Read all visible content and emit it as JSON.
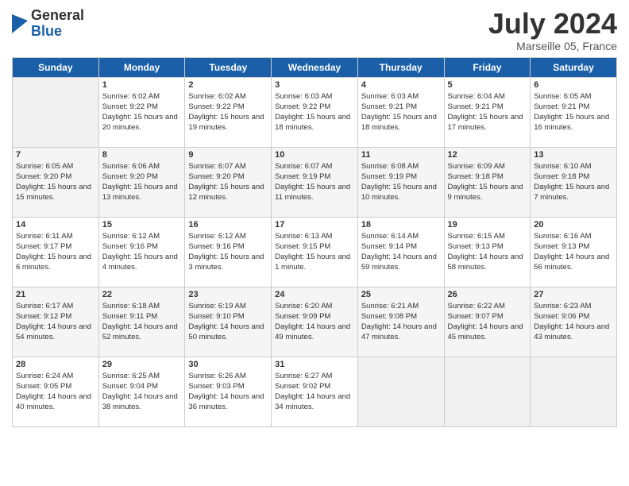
{
  "logo": {
    "general": "General",
    "blue": "Blue"
  },
  "title": "July 2024",
  "subtitle": "Marseille 05, France",
  "days_of_week": [
    "Sunday",
    "Monday",
    "Tuesday",
    "Wednesday",
    "Thursday",
    "Friday",
    "Saturday"
  ],
  "weeks": [
    [
      {
        "day": "",
        "empty": true
      },
      {
        "day": "1",
        "sunrise": "Sunrise: 6:02 AM",
        "sunset": "Sunset: 9:22 PM",
        "daylight": "Daylight: 15 hours and 20 minutes."
      },
      {
        "day": "2",
        "sunrise": "Sunrise: 6:02 AM",
        "sunset": "Sunset: 9:22 PM",
        "daylight": "Daylight: 15 hours and 19 minutes."
      },
      {
        "day": "3",
        "sunrise": "Sunrise: 6:03 AM",
        "sunset": "Sunset: 9:22 PM",
        "daylight": "Daylight: 15 hours and 18 minutes."
      },
      {
        "day": "4",
        "sunrise": "Sunrise: 6:03 AM",
        "sunset": "Sunset: 9:21 PM",
        "daylight": "Daylight: 15 hours and 18 minutes."
      },
      {
        "day": "5",
        "sunrise": "Sunrise: 6:04 AM",
        "sunset": "Sunset: 9:21 PM",
        "daylight": "Daylight: 15 hours and 17 minutes."
      },
      {
        "day": "6",
        "sunrise": "Sunrise: 6:05 AM",
        "sunset": "Sunset: 9:21 PM",
        "daylight": "Daylight: 15 hours and 16 minutes."
      }
    ],
    [
      {
        "day": "7",
        "sunrise": "Sunrise: 6:05 AM",
        "sunset": "Sunset: 9:20 PM",
        "daylight": "Daylight: 15 hours and 15 minutes."
      },
      {
        "day": "8",
        "sunrise": "Sunrise: 6:06 AM",
        "sunset": "Sunset: 9:20 PM",
        "daylight": "Daylight: 15 hours and 13 minutes."
      },
      {
        "day": "9",
        "sunrise": "Sunrise: 6:07 AM",
        "sunset": "Sunset: 9:20 PM",
        "daylight": "Daylight: 15 hours and 12 minutes."
      },
      {
        "day": "10",
        "sunrise": "Sunrise: 6:07 AM",
        "sunset": "Sunset: 9:19 PM",
        "daylight": "Daylight: 15 hours and 11 minutes."
      },
      {
        "day": "11",
        "sunrise": "Sunrise: 6:08 AM",
        "sunset": "Sunset: 9:19 PM",
        "daylight": "Daylight: 15 hours and 10 minutes."
      },
      {
        "day": "12",
        "sunrise": "Sunrise: 6:09 AM",
        "sunset": "Sunset: 9:18 PM",
        "daylight": "Daylight: 15 hours and 9 minutes."
      },
      {
        "day": "13",
        "sunrise": "Sunrise: 6:10 AM",
        "sunset": "Sunset: 9:18 PM",
        "daylight": "Daylight: 15 hours and 7 minutes."
      }
    ],
    [
      {
        "day": "14",
        "sunrise": "Sunrise: 6:11 AM",
        "sunset": "Sunset: 9:17 PM",
        "daylight": "Daylight: 15 hours and 6 minutes."
      },
      {
        "day": "15",
        "sunrise": "Sunrise: 6:12 AM",
        "sunset": "Sunset: 9:16 PM",
        "daylight": "Daylight: 15 hours and 4 minutes."
      },
      {
        "day": "16",
        "sunrise": "Sunrise: 6:12 AM",
        "sunset": "Sunset: 9:16 PM",
        "daylight": "Daylight: 15 hours and 3 minutes."
      },
      {
        "day": "17",
        "sunrise": "Sunrise: 6:13 AM",
        "sunset": "Sunset: 9:15 PM",
        "daylight": "Daylight: 15 hours and 1 minute."
      },
      {
        "day": "18",
        "sunrise": "Sunrise: 6:14 AM",
        "sunset": "Sunset: 9:14 PM",
        "daylight": "Daylight: 14 hours and 59 minutes."
      },
      {
        "day": "19",
        "sunrise": "Sunrise: 6:15 AM",
        "sunset": "Sunset: 9:13 PM",
        "daylight": "Daylight: 14 hours and 58 minutes."
      },
      {
        "day": "20",
        "sunrise": "Sunrise: 6:16 AM",
        "sunset": "Sunset: 9:13 PM",
        "daylight": "Daylight: 14 hours and 56 minutes."
      }
    ],
    [
      {
        "day": "21",
        "sunrise": "Sunrise: 6:17 AM",
        "sunset": "Sunset: 9:12 PM",
        "daylight": "Daylight: 14 hours and 54 minutes."
      },
      {
        "day": "22",
        "sunrise": "Sunrise: 6:18 AM",
        "sunset": "Sunset: 9:11 PM",
        "daylight": "Daylight: 14 hours and 52 minutes."
      },
      {
        "day": "23",
        "sunrise": "Sunrise: 6:19 AM",
        "sunset": "Sunset: 9:10 PM",
        "daylight": "Daylight: 14 hours and 50 minutes."
      },
      {
        "day": "24",
        "sunrise": "Sunrise: 6:20 AM",
        "sunset": "Sunset: 9:09 PM",
        "daylight": "Daylight: 14 hours and 49 minutes."
      },
      {
        "day": "25",
        "sunrise": "Sunrise: 6:21 AM",
        "sunset": "Sunset: 9:08 PM",
        "daylight": "Daylight: 14 hours and 47 minutes."
      },
      {
        "day": "26",
        "sunrise": "Sunrise: 6:22 AM",
        "sunset": "Sunset: 9:07 PM",
        "daylight": "Daylight: 14 hours and 45 minutes."
      },
      {
        "day": "27",
        "sunrise": "Sunrise: 6:23 AM",
        "sunset": "Sunset: 9:06 PM",
        "daylight": "Daylight: 14 hours and 43 minutes."
      }
    ],
    [
      {
        "day": "28",
        "sunrise": "Sunrise: 6:24 AM",
        "sunset": "Sunset: 9:05 PM",
        "daylight": "Daylight: 14 hours and 40 minutes."
      },
      {
        "day": "29",
        "sunrise": "Sunrise: 6:25 AM",
        "sunset": "Sunset: 9:04 PM",
        "daylight": "Daylight: 14 hours and 38 minutes."
      },
      {
        "day": "30",
        "sunrise": "Sunrise: 6:26 AM",
        "sunset": "Sunset: 9:03 PM",
        "daylight": "Daylight: 14 hours and 36 minutes."
      },
      {
        "day": "31",
        "sunrise": "Sunrise: 6:27 AM",
        "sunset": "Sunset: 9:02 PM",
        "daylight": "Daylight: 14 hours and 34 minutes."
      },
      {
        "day": "",
        "empty": true
      },
      {
        "day": "",
        "empty": true
      },
      {
        "day": "",
        "empty": true
      }
    ]
  ]
}
